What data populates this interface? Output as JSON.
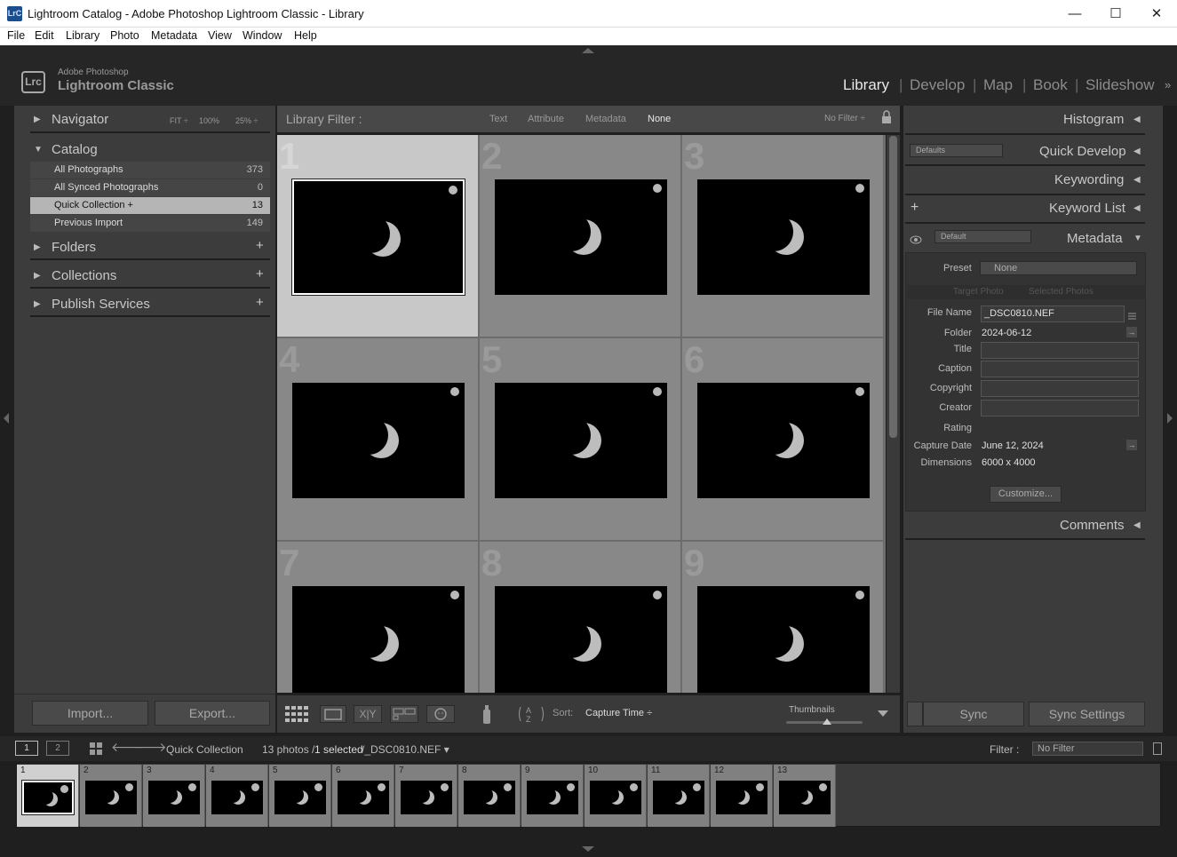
{
  "window": {
    "title": "Lightroom Catalog - Adobe Photoshop Lightroom Classic - Library",
    "app_icon": "LrC",
    "minimize": "—",
    "maximize": "☐",
    "close": "✕"
  },
  "menu": [
    "File",
    "Edit",
    "Library",
    "Photo",
    "Metadata",
    "View",
    "Window",
    "Help"
  ],
  "brand": {
    "small": "Adobe Photoshop",
    "big": "Lightroom Classic",
    "logo": "Lrc"
  },
  "modules": [
    "Library",
    "Develop",
    "Map",
    "Book",
    "Slideshow"
  ],
  "modules_sep": "|",
  "left": {
    "navigator": {
      "label": "Navigator",
      "fit": "FIT ÷",
      "z100": "100%",
      "z25": "25% ÷"
    },
    "catalog": {
      "label": "Catalog",
      "items": [
        {
          "name": "All Photographs",
          "count": "373"
        },
        {
          "name": "All Synced Photographs",
          "count": "0"
        },
        {
          "name": "Quick Collection  +",
          "count": "13"
        },
        {
          "name": "Previous Import",
          "count": "149"
        }
      ]
    },
    "folders": "Folders",
    "collections": "Collections",
    "publish": "Publish Services",
    "plus": "+",
    "import": "Import...",
    "export": "Export..."
  },
  "filter": {
    "label": "Library Filter :",
    "text": "Text",
    "attribute": "Attribute",
    "metadata": "Metadata",
    "none": "None",
    "preset": "No Filter ÷"
  },
  "grid": {
    "numbers": [
      "1",
      "2",
      "3",
      "4",
      "5",
      "6",
      "7",
      "8",
      "9"
    ]
  },
  "toolbar": {
    "sort_label": "Sort:",
    "sort_value": "Capture Time ÷",
    "thumbnails": "Thumbnails",
    "xy": "X|Y"
  },
  "right": {
    "histogram": "Histogram",
    "quick_develop": "Quick Develop",
    "qd_preset": "Defaults",
    "keywording": "Keywording",
    "keyword_list": "Keyword List",
    "metadata": "Metadata",
    "meta_preset": "Default",
    "preset_label": "Preset",
    "preset_value": "None",
    "target_photo": "Target Photo",
    "selected_photos": "Selected Photos",
    "fields": {
      "file_name_label": "File Name",
      "file_name": "_DSC0810.NEF",
      "folder_label": "Folder",
      "folder": "2024-06-12",
      "title_label": "Title",
      "caption_label": "Caption",
      "copyright_label": "Copyright",
      "creator_label": "Creator",
      "rating_label": "Rating",
      "capture_date_label": "Capture Date",
      "capture_date": "June 12, 2024",
      "dimensions_label": "Dimensions",
      "dimensions": "6000 x 4000"
    },
    "customize": "Customize...",
    "comments": "Comments",
    "sync": "Sync",
    "sync_settings": "Sync Settings"
  },
  "filmbar": {
    "screen1": "1",
    "screen2": "2",
    "source": "Quick Collection",
    "count": "13 photos /",
    "selected": "1 selected",
    "file": "/_DSC0810.NEF ▾",
    "filter_label": "Filter :",
    "filter_value": "No Filter"
  },
  "filmstrip": {
    "numbers": [
      "1",
      "2",
      "3",
      "4",
      "5",
      "6",
      "7",
      "8",
      "9",
      "10",
      "11",
      "12",
      "13"
    ]
  }
}
